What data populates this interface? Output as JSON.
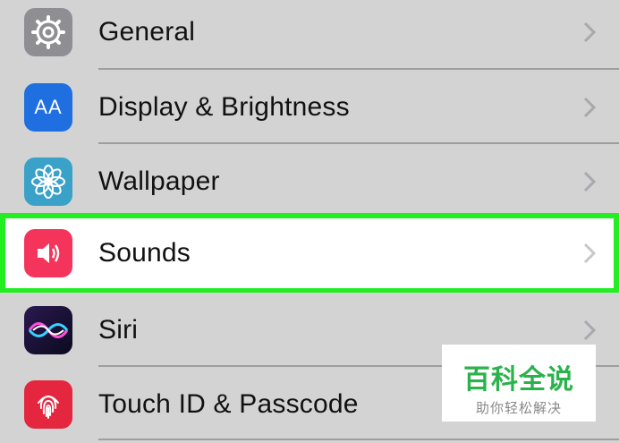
{
  "settings": {
    "items": [
      {
        "label": "General",
        "icon": "gear-icon",
        "icon_color": "#8e8e93"
      },
      {
        "label": "Display & Brightness",
        "icon": "text-size-icon",
        "icon_color": "#1f6fe0"
      },
      {
        "label": "Wallpaper",
        "icon": "flower-icon",
        "icon_color": "#3aa1c9"
      },
      {
        "label": "Sounds",
        "icon": "speaker-icon",
        "icon_color": "#f4345a",
        "highlighted": true
      },
      {
        "label": "Siri",
        "icon": "siri-icon",
        "icon_color": "#1a1a3a"
      },
      {
        "label": "Touch ID & Passcode",
        "icon": "fingerprint-icon",
        "icon_color": "#e5263f"
      }
    ],
    "display_icon_text": "AA",
    "highlight_color": "#22ee22"
  },
  "watermark": {
    "main": "百科全说",
    "sub": "助你轻松解决"
  }
}
